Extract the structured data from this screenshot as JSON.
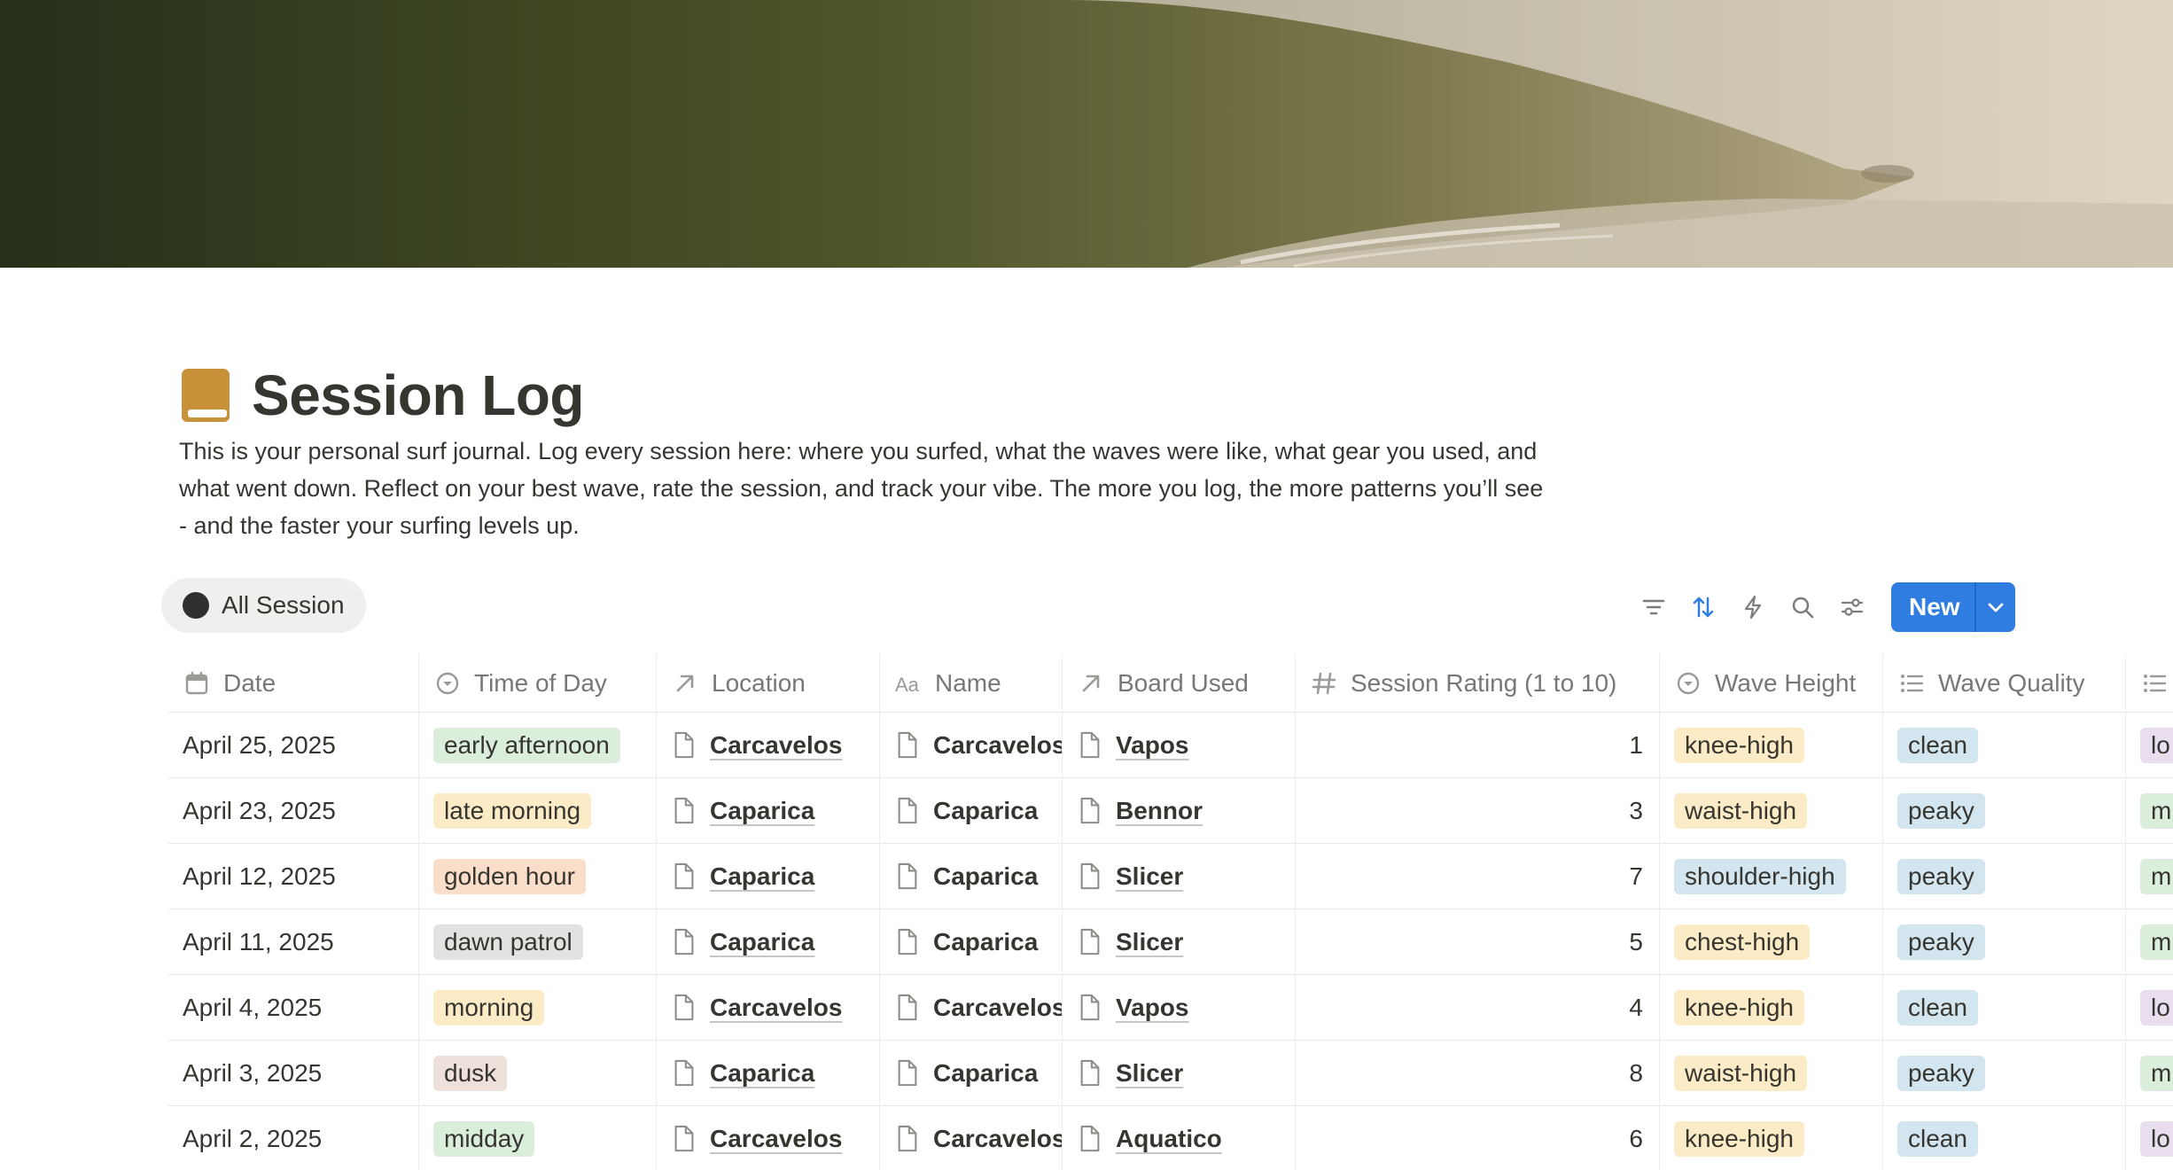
{
  "page": {
    "title": "Session Log",
    "icon": "book-icon",
    "description": "This is your personal surf journal. Log every session here: where you surfed, what the waves were like, what gear you used, and what went down. Reflect on your best wave, rate the session, and track your vibe. The more you log, the more patterns you’ll see - and the faster your surfing levels up."
  },
  "view": {
    "tab_label": "All Session"
  },
  "toolbar": {
    "icons": [
      "filter-icon",
      "sort-icon",
      "automation-icon",
      "search-icon",
      "settings-icon"
    ],
    "new_label": "New",
    "accent": "#2f7de1"
  },
  "columns": [
    {
      "label": "Date",
      "icon": "calendar-icon"
    },
    {
      "label": "Time of Day",
      "icon": "select-icon"
    },
    {
      "label": "Location",
      "icon": "relation-icon"
    },
    {
      "label": "Name",
      "icon": "title-icon"
    },
    {
      "label": "Board Used",
      "icon": "relation-icon"
    },
    {
      "label": "Session Rating (1 to 10)",
      "icon": "number-icon"
    },
    {
      "label": "Wave Height",
      "icon": "select-icon"
    },
    {
      "label": "Wave Quality",
      "icon": "multiselect-icon"
    },
    {
      "label": "",
      "icon": "multiselect-icon"
    }
  ],
  "tag_colors": {
    "green": "#dbeddb",
    "yellow": "#fbecc7",
    "orange": "#fadec9",
    "gray": "#e3e2e0",
    "brown": "#eee0da",
    "blue": "#d3e5ef",
    "purple": "#e8deee"
  },
  "rows": [
    {
      "date": "April 25, 2025",
      "time": "early afternoon",
      "time_color": "green",
      "location": "Carcavelos",
      "name": "Carcavelos",
      "board": "Vapos",
      "rating": "1",
      "height": "knee-high",
      "height_color": "yellow",
      "quality": "clean",
      "extra": "lo",
      "extra_color": "purple"
    },
    {
      "date": "April 23, 2025",
      "time": "late morning",
      "time_color": "yellow",
      "location": "Caparica",
      "name": "Caparica",
      "board": "Bennor",
      "rating": "3",
      "height": "waist-high",
      "height_color": "yellow",
      "quality": "peaky",
      "extra": "m",
      "extra_color": "green"
    },
    {
      "date": "April 12, 2025",
      "time": "golden hour",
      "time_color": "orange",
      "location": "Caparica",
      "name": "Caparica",
      "board": "Slicer",
      "rating": "7",
      "height": "shoulder-high",
      "height_color": "blue",
      "quality": "peaky",
      "extra": "m",
      "extra_color": "green"
    },
    {
      "date": "April 11, 2025",
      "time": "dawn patrol",
      "time_color": "gray",
      "location": "Caparica",
      "name": "Caparica",
      "board": "Slicer",
      "rating": "5",
      "height": "chest-high",
      "height_color": "yellow",
      "quality": "peaky",
      "extra": "m",
      "extra_color": "green"
    },
    {
      "date": "April 4, 2025",
      "time": "morning",
      "time_color": "yellow",
      "location": "Carcavelos",
      "name": "Carcavelos",
      "board": "Vapos",
      "rating": "4",
      "height": "knee-high",
      "height_color": "yellow",
      "quality": "clean",
      "extra": "lo",
      "extra_color": "purple"
    },
    {
      "date": "April 3, 2025",
      "time": "dusk",
      "time_color": "brown",
      "location": "Caparica",
      "name": "Caparica",
      "board": "Slicer",
      "rating": "8",
      "height": "waist-high",
      "height_color": "yellow",
      "quality": "peaky",
      "extra": "m",
      "extra_color": "green"
    },
    {
      "date": "April 2, 2025",
      "time": "midday",
      "time_color": "green",
      "location": "Carcavelos",
      "name": "Carcavelos",
      "board": "Aquatico",
      "rating": "6",
      "height": "knee-high",
      "height_color": "yellow",
      "quality": "clean",
      "extra": "lo",
      "extra_color": "purple"
    }
  ]
}
